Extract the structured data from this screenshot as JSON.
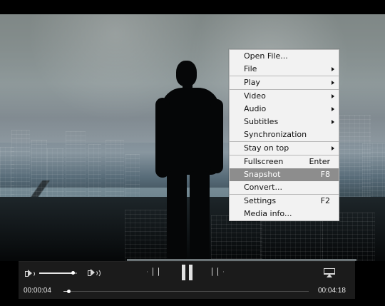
{
  "menu": {
    "items": [
      {
        "label": "Open File...",
        "shortcut": "",
        "submenu": false,
        "selected": false
      },
      {
        "label": "File",
        "shortcut": "",
        "submenu": true,
        "selected": false
      },
      {
        "label": "Play",
        "shortcut": "",
        "submenu": true,
        "selected": false
      },
      {
        "label": "Video",
        "shortcut": "",
        "submenu": true,
        "selected": false
      },
      {
        "label": "Audio",
        "shortcut": "",
        "submenu": true,
        "selected": false
      },
      {
        "label": "Subtitles",
        "shortcut": "",
        "submenu": true,
        "selected": false
      },
      {
        "label": "Synchronization",
        "shortcut": "",
        "submenu": false,
        "selected": false
      },
      {
        "label": "Stay on top",
        "shortcut": "",
        "submenu": true,
        "selected": false
      },
      {
        "label": "Fullscreen",
        "shortcut": "Enter",
        "submenu": false,
        "selected": false
      },
      {
        "label": "Snapshot",
        "shortcut": "F8",
        "submenu": false,
        "selected": true
      },
      {
        "label": "Convert...",
        "shortcut": "",
        "submenu": false,
        "selected": false
      },
      {
        "label": "Settings",
        "shortcut": "F2",
        "submenu": false,
        "selected": false
      },
      {
        "label": "Media info...",
        "shortcut": "",
        "submenu": false,
        "selected": false
      }
    ]
  },
  "controls": {
    "current_time": "00:00:04",
    "total_time": "00:04:18",
    "volume_level": 0.88,
    "progress_level": 0.02,
    "icons": {
      "volume_low": "volume-low-icon",
      "volume_high": "volume-high-icon",
      "rewind": "rewind-icon",
      "pause": "pause-icon",
      "forward": "forward-icon",
      "airplay": "airplay-icon"
    }
  },
  "colors": {
    "menu_background": "#f2f2f2",
    "menu_selected": "#8d8d8d",
    "controls_background": "#1b1b1b"
  }
}
